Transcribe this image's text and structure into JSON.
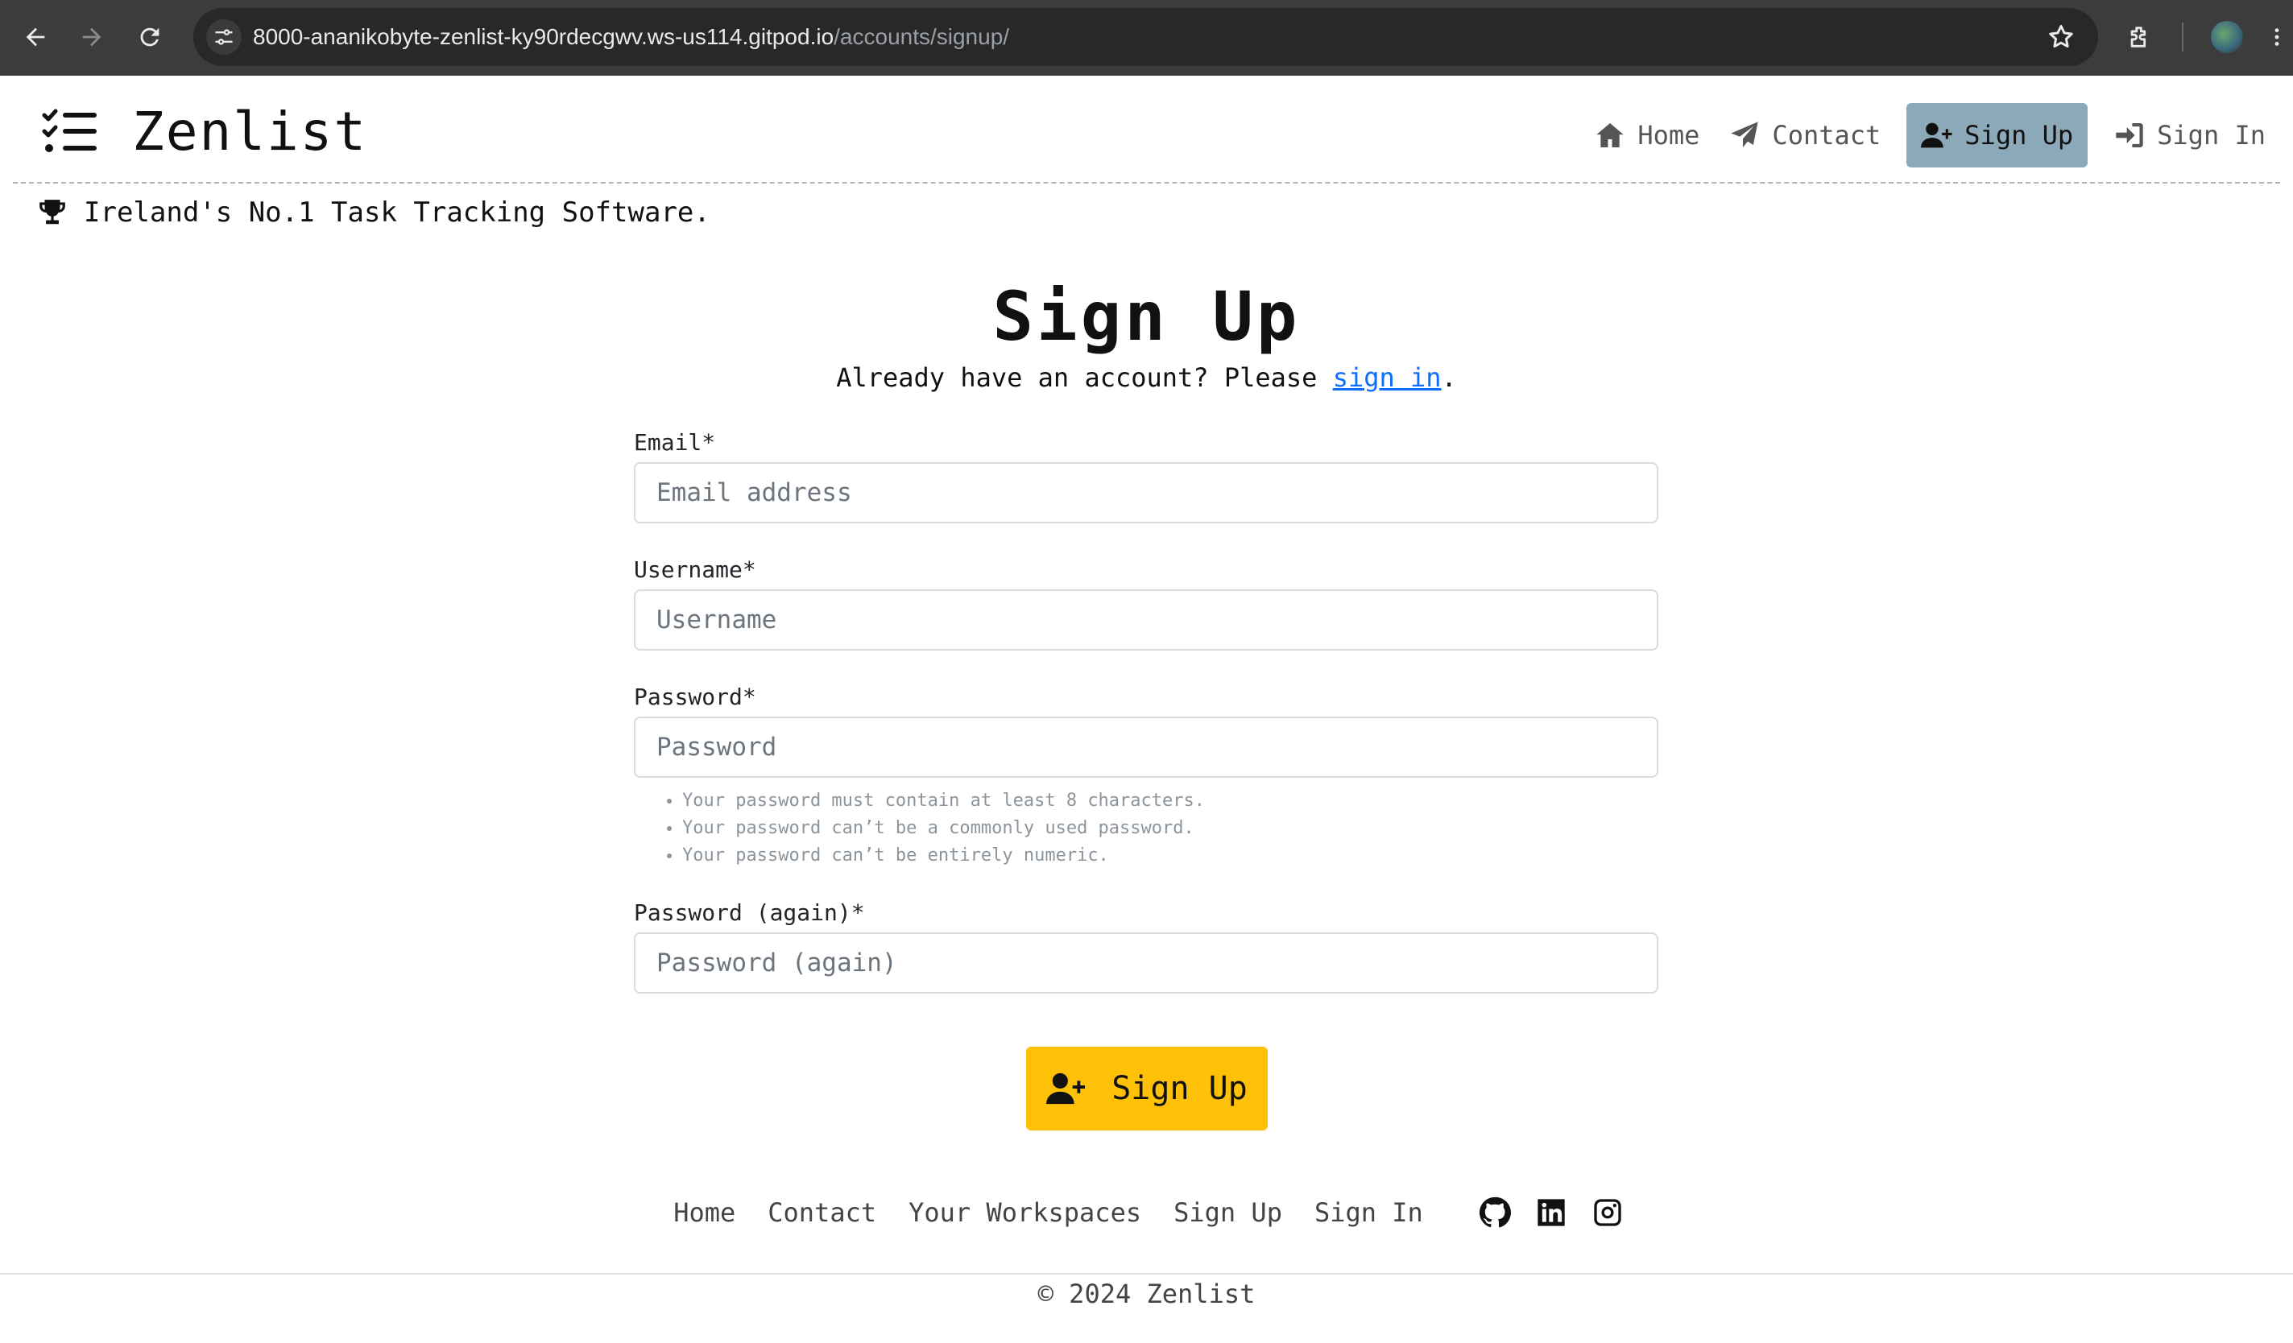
{
  "browser": {
    "url_host": "8000-ananikobyte-zenlist-ky90rdecgwv.ws-us114.gitpod.io",
    "url_path": "/accounts/signup/",
    "icons": [
      "back-arrow-icon",
      "forward-arrow-icon",
      "reload-icon",
      "site-settings-icon",
      "bookmark-star-icon",
      "extensions-icon",
      "profile-avatar-icon",
      "more-menu-icon"
    ]
  },
  "header": {
    "brand": "Zenlist",
    "brand_icon": "checklist-icon",
    "nav": [
      {
        "label": "Home",
        "icon": "home-icon",
        "active": false
      },
      {
        "label": "Contact",
        "icon": "paper-plane-icon",
        "active": false
      },
      {
        "label": "Sign Up",
        "icon": "user-plus-icon",
        "active": true
      },
      {
        "label": "Sign In",
        "icon": "sign-in-icon",
        "active": false
      }
    ],
    "active_color": "#8ba9b8"
  },
  "tagline": {
    "icon": "trophy-icon",
    "text": "Ireland's No.1 Task Tracking Software."
  },
  "main": {
    "title": "Sign Up",
    "subtitle_prefix": "Already have an account? Please ",
    "subtitle_link": "sign in",
    "subtitle_suffix": ".",
    "fields": {
      "email": {
        "label": "Email*",
        "placeholder": "Email address"
      },
      "username": {
        "label": "Username*",
        "placeholder": "Username"
      },
      "password": {
        "label": "Password*",
        "placeholder": "Password",
        "help": [
          "Your password must contain at least 8 characters.",
          "Your password can’t be a commonly used password.",
          "Your password can’t be entirely numeric."
        ]
      },
      "password2": {
        "label": "Password (again)*",
        "placeholder": "Password (again)"
      }
    },
    "submit_label": "Sign Up",
    "submit_color": "#ffc107"
  },
  "footer": {
    "links": [
      "Home",
      "Contact",
      "Your Workspaces",
      "Sign Up",
      "Sign In"
    ],
    "social_icons": [
      "github-icon",
      "linkedin-icon",
      "instagram-icon"
    ],
    "copyright": "© 2024 Zenlist"
  }
}
